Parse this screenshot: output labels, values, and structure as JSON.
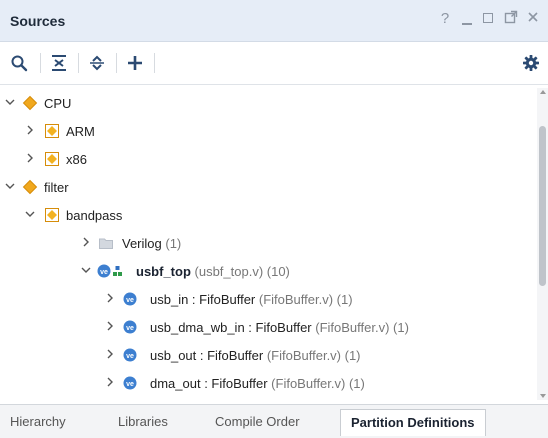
{
  "window": {
    "title": "Sources",
    "controls": {
      "help": "?",
      "minimize": "minimize",
      "maximize": "maximize",
      "float": "float",
      "close": "close"
    }
  },
  "toolbar": {
    "icons": [
      "search-icon",
      "collapse-all-icon",
      "expand-all-icon",
      "add-icon",
      "gear-icon"
    ]
  },
  "tree": [
    {
      "name": "CPU",
      "meta": "",
      "expanded": true,
      "icon": "diamond-icon"
    },
    {
      "name": "ARM",
      "meta": "",
      "expanded": false,
      "icon": "partition-icon"
    },
    {
      "name": "x86",
      "meta": "",
      "expanded": false,
      "icon": "partition-icon"
    },
    {
      "name": "filter",
      "meta": "",
      "expanded": true,
      "icon": "diamond-icon"
    },
    {
      "name": "bandpass",
      "meta": "",
      "expanded": true,
      "icon": "partition-icon"
    },
    {
      "name": "Verilog",
      "meta": "(1)",
      "expanded": false,
      "icon": "folder-icon"
    },
    {
      "name": "usbf_top",
      "meta": "(usbf_top.v) (10)",
      "expanded": true,
      "icon": "verilog-top-icon"
    },
    {
      "name": "usb_in : FifoBuffer",
      "meta": "(FifoBuffer.v) (1)",
      "expanded": false,
      "icon": "verilog-module-icon"
    },
    {
      "name": "usb_dma_wb_in : FifoBuffer",
      "meta": "(FifoBuffer.v) (1)",
      "expanded": false,
      "icon": "verilog-module-icon"
    },
    {
      "name": "usb_out : FifoBuffer",
      "meta": "(FifoBuffer.v) (1)",
      "expanded": false,
      "icon": "verilog-module-icon"
    },
    {
      "name": "dma_out : FifoBuffer",
      "meta": "(FifoBuffer.v) (1)",
      "expanded": false,
      "icon": "verilog-module-icon"
    }
  ],
  "tabs": [
    {
      "label": "Hierarchy",
      "active": false
    },
    {
      "label": "Libraries",
      "active": false
    },
    {
      "label": "Compile Order",
      "active": false
    },
    {
      "label": "Partition Definitions",
      "active": true
    }
  ],
  "colors": {
    "diamond": "#f0a81e",
    "partition": "#f3b221",
    "verilog": "#3d7fd0",
    "folder": "#c9ced6",
    "accent": "#2f6fc0"
  }
}
